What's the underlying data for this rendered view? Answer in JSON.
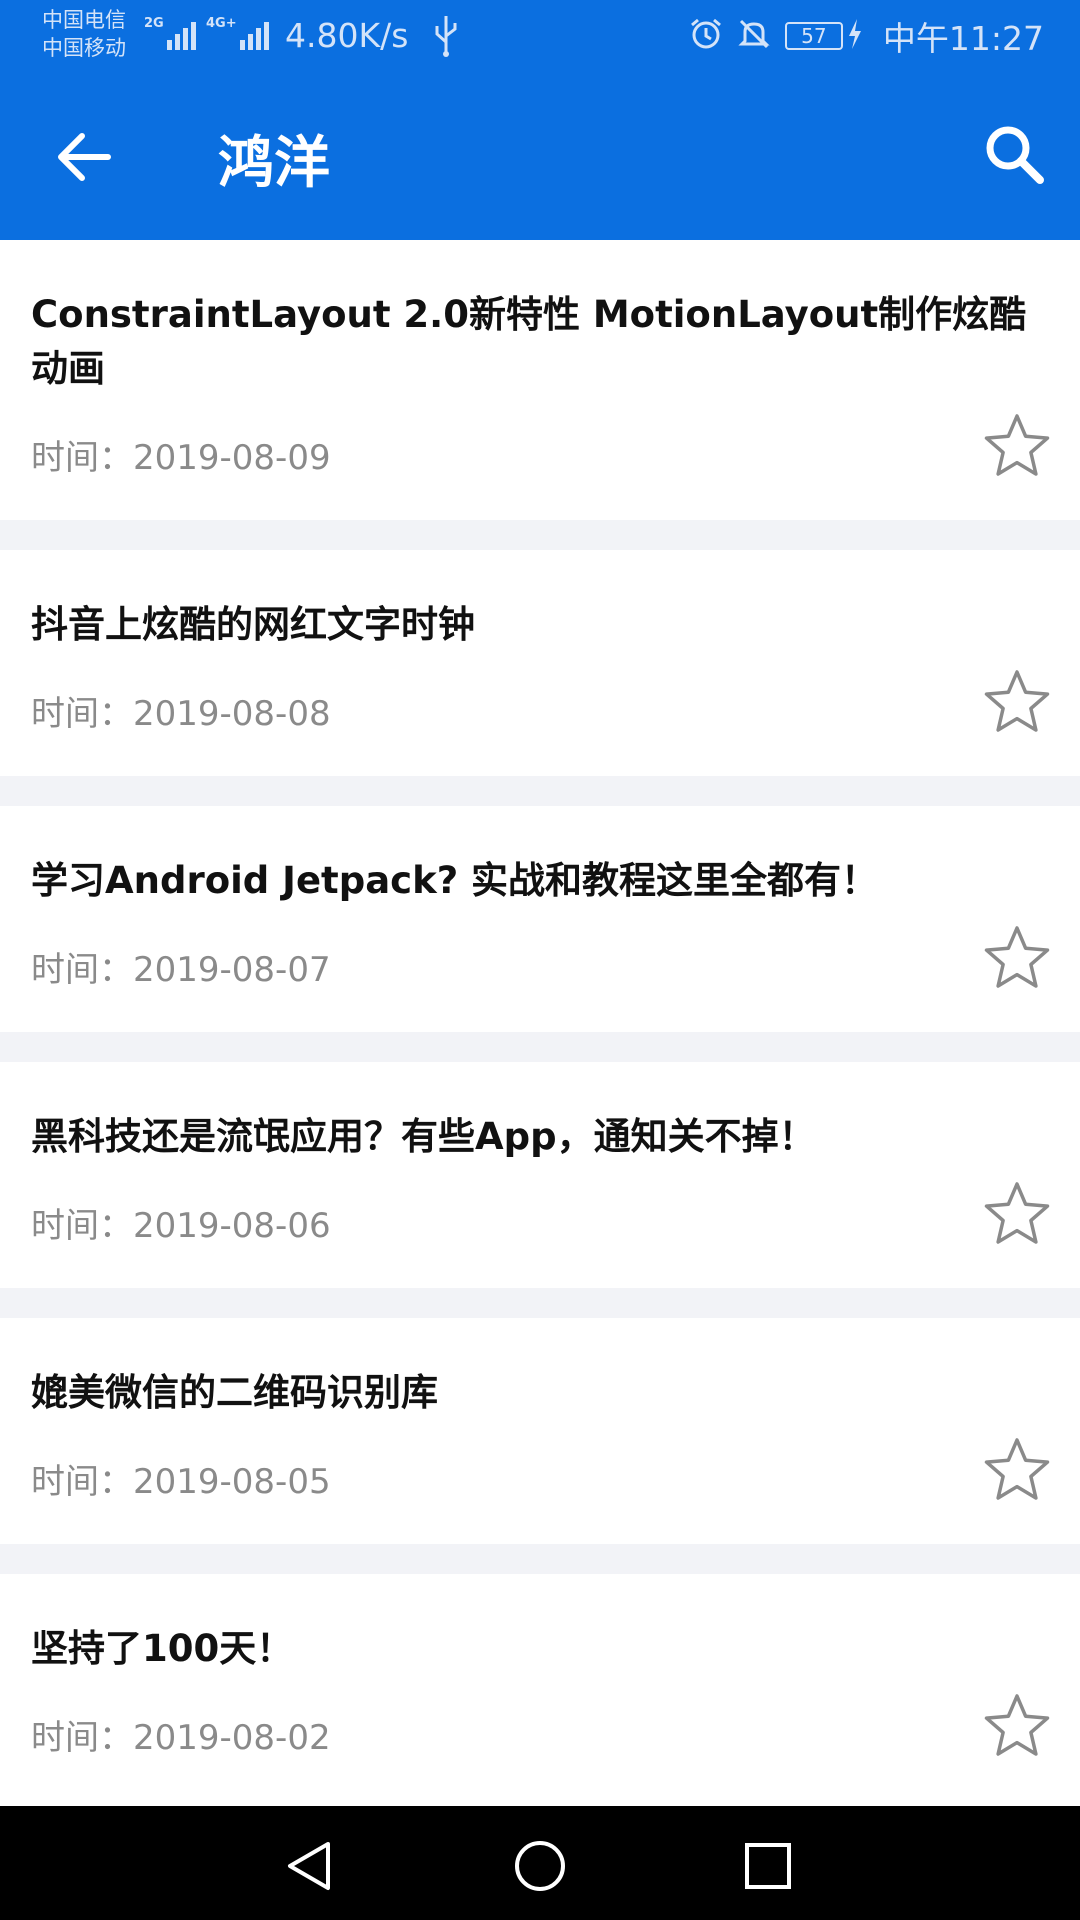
{
  "status_bar": {
    "carrier_1": "中国电信",
    "carrier_2": "中国移动",
    "net_1": "2G",
    "net_2": "4G+",
    "speed": "4.80K/s",
    "battery": "57",
    "time": "中午11:27"
  },
  "app_bar": {
    "title": "鸿洋",
    "back_icon": "arrow-back-icon",
    "search_icon": "search-icon"
  },
  "articles": [
    {
      "title": "ConstraintLayout 2.0新特性 MotionLayout制作炫酷动画",
      "date": "时间：2019-08-09"
    },
    {
      "title": "抖音上炫酷的网红文字时钟",
      "date": "时间：2019-08-08"
    },
    {
      "title": "学习Android Jetpack? 实战和教程这里全都有！",
      "date": "时间：2019-08-07"
    },
    {
      "title": "黑科技还是流氓应用？有些App，通知关不掉！",
      "date": "时间：2019-08-06"
    },
    {
      "title": "媲美微信的二维码识别库",
      "date": "时间：2019-08-05"
    },
    {
      "title": "坚持了100天！",
      "date": "时间：2019-08-02"
    }
  ],
  "colors": {
    "primary": "#0b6fe0",
    "background": "#f2f3f7",
    "card": "#ffffff",
    "title_text": "#111111",
    "date_text": "#8a8a8a",
    "star_outline": "#8a8a8a"
  },
  "nav_bar": {
    "back_icon": "triangle-back-icon",
    "home_icon": "circle-home-icon",
    "recents_icon": "square-recents-icon"
  }
}
